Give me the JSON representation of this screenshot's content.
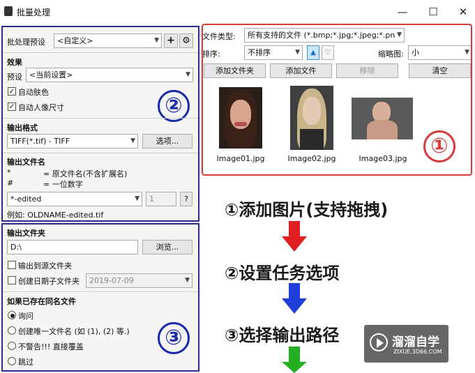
{
  "window": {
    "title": "批量处理",
    "min": "—",
    "max": "☐",
    "close": "✕"
  },
  "presets": {
    "label": "批处理预设",
    "value": "<自定义>",
    "add": "+",
    "gear": "⚙"
  },
  "effects": {
    "title": "效果",
    "preset_label": "预设",
    "preset_value": "<当前设置>",
    "auto_skin": "自动肤色",
    "auto_portrait": "自动人像尺寸"
  },
  "output_format": {
    "title": "输出格式",
    "value": "TIFF(*.tif) - TIFF",
    "options_button": "选项..."
  },
  "output_name": {
    "title": "输出文件名",
    "legend1_sym": "*",
    "legend1_text": "= 原文件名(不含扩展名)",
    "legend2_sym": "#",
    "legend2_text": "= 一位数字",
    "pattern": "*-edited",
    "digits": "1",
    "help": "?",
    "example": "例如:  OLDNAME-edited.tif"
  },
  "output_folder": {
    "title": "输出文件夹",
    "path": "D:\\",
    "browse": "浏览...",
    "to_source": "输出到源文件夹",
    "date_subfolder": "创建日期子文件夹",
    "date_value": "2019-07-09"
  },
  "conflict": {
    "title": "如果已存在同名文件",
    "opt1": "询问",
    "opt2": "创建唯一文件名 (如 (1), (2) 等.)",
    "opt3": "不警告!!! 直接覆盖",
    "opt4": "跳过"
  },
  "files": {
    "type_label": "文件类型:",
    "type_value": "所有支持的文件 (*.bmp;*.jpg;*.jpeg;*.pn",
    "sort_label": "排序:",
    "sort_value": "不排序",
    "sort_asc": "▲",
    "sort_desc": "▽",
    "thumb_label": "缩略图:",
    "thumb_value": "小",
    "add_folder": "添加文件夹",
    "add_file": "添加文件",
    "remove": "移除",
    "clear": "清空",
    "images": [
      {
        "name": "Image01.jpg"
      },
      {
        "name": "Image02.jpg"
      },
      {
        "name": "Image03.jpg"
      }
    ]
  },
  "annotations": {
    "num1": "①",
    "num2": "②",
    "num3": "③",
    "step1": "①添加图片(支持拖拽)",
    "step2": "②设置任务选项",
    "step3": "③选择输出路径",
    "arrow_colors": [
      "#e02020",
      "#1e3fd8",
      "#22b022"
    ],
    "highlight_color": "#d63a3a",
    "panel_color": "#2b2b8c"
  },
  "watermark": {
    "name": "溜溜自学",
    "url": "ZIXUE.3D66.COM"
  }
}
